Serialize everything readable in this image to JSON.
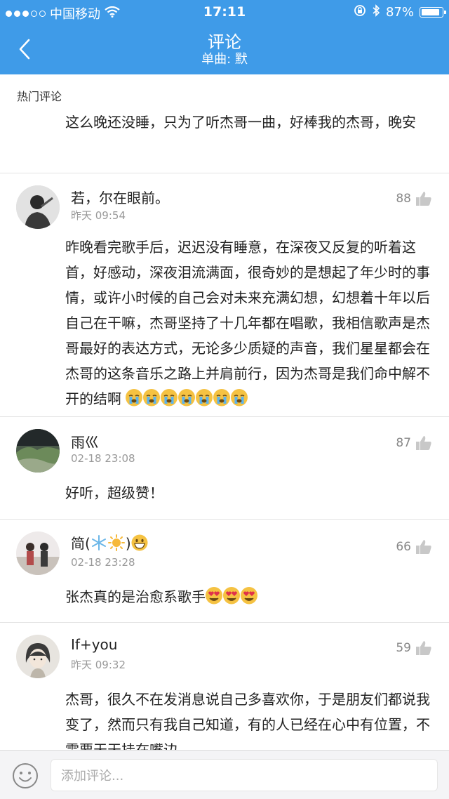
{
  "status_bar": {
    "carrier": "中国移动",
    "time": "17:11",
    "battery": "87%",
    "battery_level": 0.87
  },
  "nav": {
    "title": "评论",
    "subtitle": "单曲: 默"
  },
  "section_title": "热门评论",
  "top_comment_continuation": "这么晚还没睡，只为了听杰哥一曲，好棒我的杰哥，晚安",
  "comments": [
    {
      "username": "若，尔在眼前。",
      "time": "昨天 09:54",
      "likes": "88",
      "text": "昨晚看完歌手后，迟迟没有睡意，在深夜又反复的听着这首，好感动，深夜泪流满面，很奇妙的是想起了年少时的事情，或许小时候的自己会对未来充满幻想，幻想着十年以后自己在干嘛，杰哥坚持了十几年都在唱歌，我相信歌声是杰哥最好的表达方式，无论多少质疑的声音，我们星星都会在杰哥的这条音乐之路上并肩前行，因为杰哥是我们命中解不开的结啊",
      "trailing_emoji": "crying-face-emoji",
      "trailing_emoji_count": 7
    },
    {
      "username": "雨巛",
      "time": "02-18 23:08",
      "likes": "87",
      "text": "好听，超级赞！"
    },
    {
      "username": "简(",
      "username_end": ")",
      "username_emojis": [
        "snowflake-emoji",
        "sun-emoji",
        "grinning-face-emoji"
      ],
      "time": "02-18 23:28",
      "likes": "66",
      "text": "张杰真的是治愈系歌手",
      "trailing_emoji": "heart-eyes-emoji",
      "trailing_emoji_count": 3
    },
    {
      "username": "If+you",
      "time": "昨天 09:32",
      "likes": "59",
      "text": "杰哥，很久不在发消息说自己多喜欢你，于是朋友们都说我变了，然而只有我自己知道，有的人已经在心中有位置，不需要天天挂在嘴边"
    }
  ],
  "input": {
    "placeholder": "添加评论..."
  },
  "colors": {
    "nav_background": "#3f9be8",
    "divider": "#e3e3e3",
    "meta_text": "#999999",
    "bottom_bar": "#f4f4f6"
  },
  "icons": [
    "back-arrow-icon",
    "wifi-icon",
    "lock-rotation-icon",
    "bluetooth-icon",
    "battery-icon",
    "thumbs-up-icon",
    "emoji-face-icon"
  ]
}
